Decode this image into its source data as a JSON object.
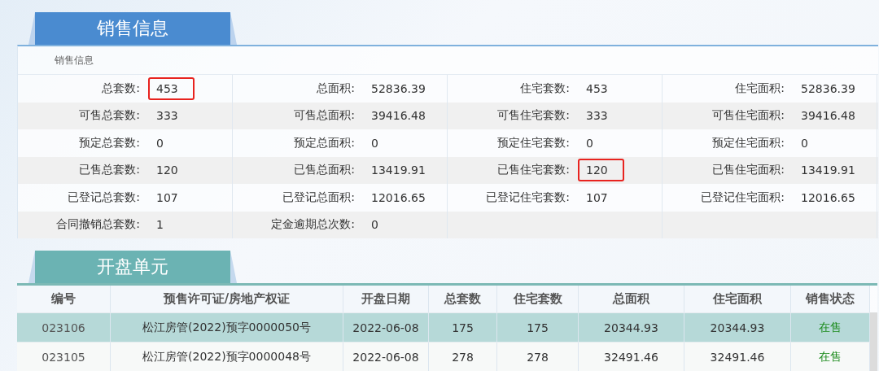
{
  "sales_section": {
    "title": "销售信息",
    "subheading": "销售信息",
    "rows": [
      [
        {
          "label": "总套数:",
          "value": "453",
          "highlighted": true
        },
        {
          "label": "总面积:",
          "value": "52836.39",
          "highlighted": false
        },
        {
          "label": "住宅套数:",
          "value": "453",
          "highlighted": false
        },
        {
          "label": "住宅面积:",
          "value": "52836.39",
          "highlighted": false
        }
      ],
      [
        {
          "label": "可售总套数:",
          "value": "333",
          "highlighted": false
        },
        {
          "label": "可售总面积:",
          "value": "39416.48",
          "highlighted": false
        },
        {
          "label": "可售住宅套数:",
          "value": "333",
          "highlighted": false
        },
        {
          "label": "可售住宅面积:",
          "value": "39416.48",
          "highlighted": false
        }
      ],
      [
        {
          "label": "预定总套数:",
          "value": "0",
          "highlighted": false
        },
        {
          "label": "预定总面积:",
          "value": "0",
          "highlighted": false
        },
        {
          "label": "预定住宅套数:",
          "value": "0",
          "highlighted": false
        },
        {
          "label": "预定住宅面积:",
          "value": "0",
          "highlighted": false
        }
      ],
      [
        {
          "label": "已售总套数:",
          "value": "120",
          "highlighted": false
        },
        {
          "label": "已售总面积:",
          "value": "13419.91",
          "highlighted": false
        },
        {
          "label": "已售住宅套数:",
          "value": "120",
          "highlighted": true
        },
        {
          "label": "已售住宅面积:",
          "value": "13419.91",
          "highlighted": false
        }
      ],
      [
        {
          "label": "已登记总套数:",
          "value": "107",
          "highlighted": false
        },
        {
          "label": "已登记总面积:",
          "value": "12016.65",
          "highlighted": false
        },
        {
          "label": "已登记住宅套数:",
          "value": "107",
          "highlighted": false
        },
        {
          "label": "已登记住宅面积:",
          "value": "12016.65",
          "highlighted": false
        }
      ],
      [
        {
          "label": "合同撤销总套数:",
          "value": "1",
          "highlighted": false
        },
        {
          "label": "定金逾期总次数:",
          "value": "0",
          "highlighted": false
        }
      ]
    ]
  },
  "units_section": {
    "title": "开盘单元",
    "table": {
      "columns": [
        "编号",
        "预售许可证/房地产权证",
        "开盘日期",
        "总套数",
        "住宅套数",
        "总面积",
        "住宅面积",
        "销售状态"
      ],
      "rows": [
        {
          "selected": true,
          "cells": [
            "023106",
            "松江房管(2022)预字0000050号",
            "2022-06-08",
            "175",
            "175",
            "20344.93",
            "20344.93",
            "在售"
          ]
        },
        {
          "selected": false,
          "cells": [
            "023105",
            "松江房管(2022)预字0000048号",
            "2022-06-08",
            "278",
            "278",
            "32491.46",
            "32491.46",
            "在售"
          ]
        }
      ]
    }
  }
}
